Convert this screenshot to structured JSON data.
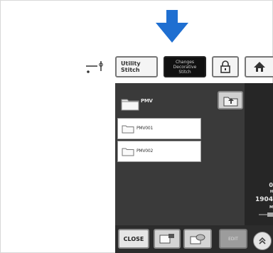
{
  "top_bar": {
    "utility_line1": "Utility",
    "utility_line2": "Stitch",
    "changes_line1": "Changes",
    "changes_line2": "Decorative",
    "changes_line3": "Stitch"
  },
  "file_browser": {
    "path": "PMV",
    "folders": [
      "PMV001",
      "PMV002"
    ]
  },
  "status": {
    "line1": "0",
    "line2": "H",
    "line3": "1904",
    "line4": "M"
  },
  "bottom_bar": {
    "close_label": "CLOSE",
    "edit_label": "EDIT"
  },
  "icons": {
    "down_arrow": "down-arrow-icon",
    "needle": "needle-icon",
    "lock": "lock-icon",
    "home": "home-icon",
    "folder": "folder-icon",
    "up_folder": "folder-up-icon",
    "send": "send-icon",
    "erase": "erase-icon",
    "cable": "usb-cable-icon",
    "scroll_up": "double-chevron-up-icon"
  },
  "colors": {
    "arrow": "#1f6fd1",
    "panel": "#2c2c2c"
  }
}
